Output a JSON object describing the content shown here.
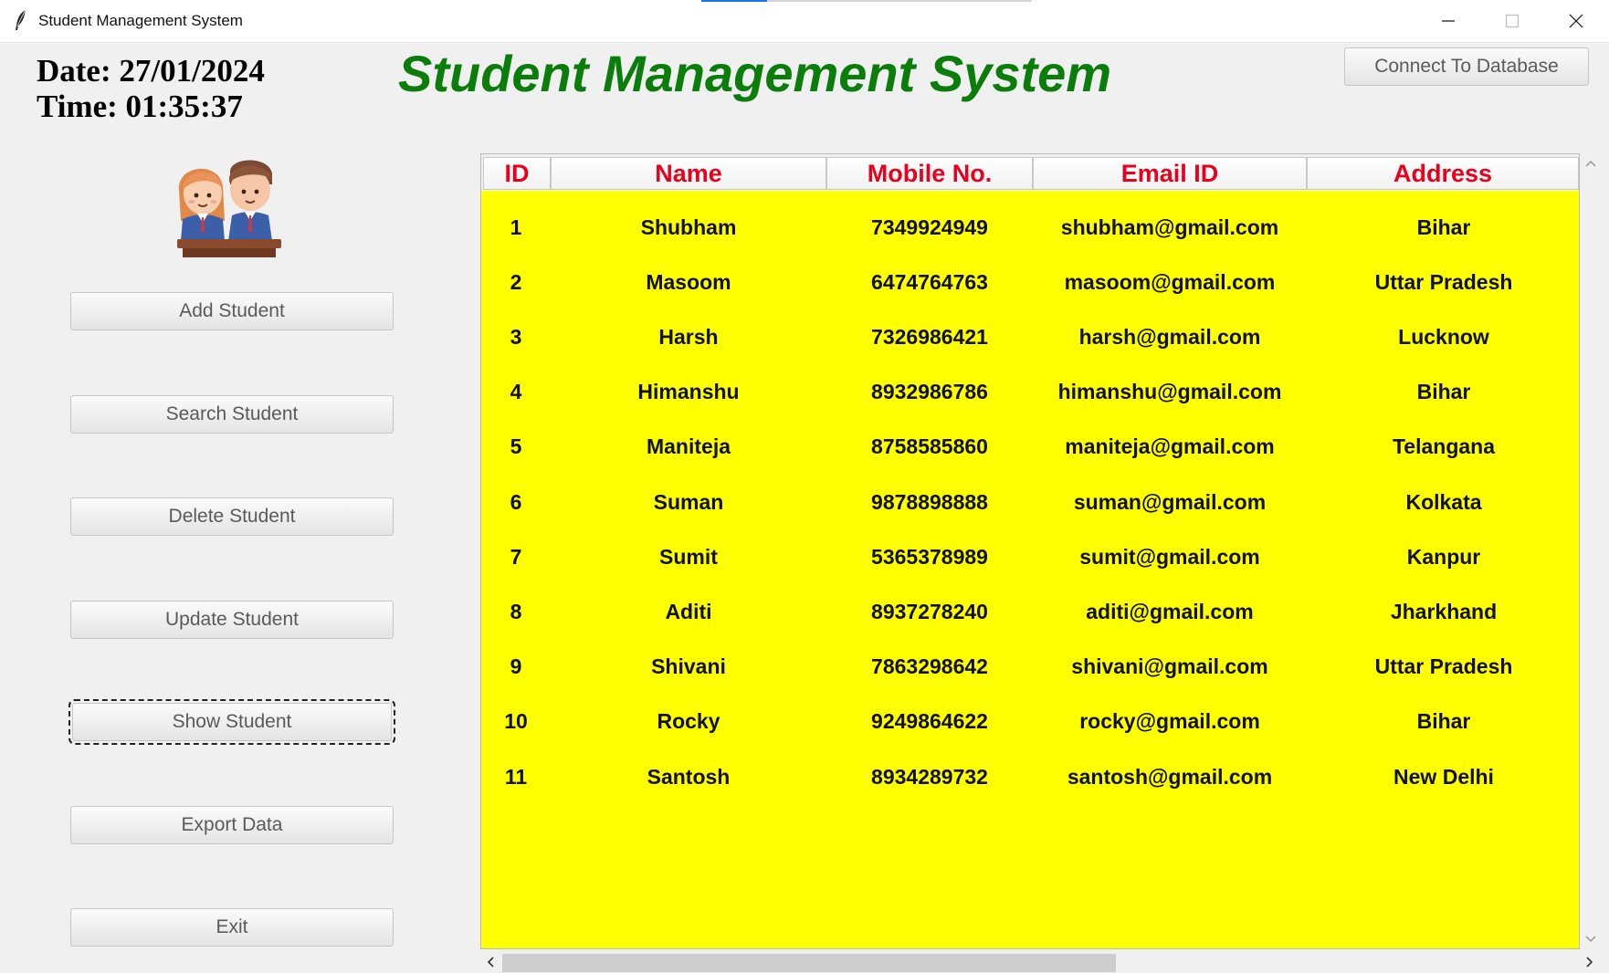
{
  "window": {
    "title": "Student Management System"
  },
  "clock": {
    "date": "Date: 27/01/2024",
    "time": "Time: 01:35:37"
  },
  "heading": "Student Management System",
  "connect_button": "Connect To Database",
  "sidebar": {
    "buttons": [
      {
        "label": "Add Student"
      },
      {
        "label": "Search Student"
      },
      {
        "label": "Delete Student"
      },
      {
        "label": "Update Student"
      },
      {
        "label": "Show Student",
        "focused": true
      },
      {
        "label": "Export Data"
      },
      {
        "label": "Exit"
      }
    ]
  },
  "table": {
    "columns": [
      "ID",
      "Name",
      "Mobile No.",
      "Email ID",
      "Address"
    ],
    "rows": [
      [
        "1",
        "Shubham",
        "7349924949",
        "shubham@gmail.com",
        "Bihar"
      ],
      [
        "2",
        "Masoom",
        "6474764763",
        "masoom@gmail.com",
        "Uttar Pradesh"
      ],
      [
        "3",
        "Harsh",
        "7326986421",
        "harsh@gmail.com",
        "Lucknow"
      ],
      [
        "4",
        "Himanshu",
        "8932986786",
        "himanshu@gmail.com",
        "Bihar"
      ],
      [
        "5",
        "Maniteja",
        "8758585860",
        "maniteja@gmail.com",
        "Telangana"
      ],
      [
        "6",
        "Suman",
        "9878898888",
        "suman@gmail.com",
        "Kolkata"
      ],
      [
        "7",
        "Sumit",
        "5365378989",
        "sumit@gmail.com",
        "Kanpur"
      ],
      [
        "8",
        "Aditi",
        "8937278240",
        "aditi@gmail.com",
        "Jharkhand"
      ],
      [
        "9",
        "Shivani",
        "7863298642",
        "shivani@gmail.com",
        "Uttar Pradesh"
      ],
      [
        "10",
        "Rocky",
        "9249864622",
        "rocky@gmail.com",
        "Bihar"
      ],
      [
        "11",
        "Santosh",
        "8934289732",
        "santosh@gmail.com",
        "New Delhi"
      ]
    ]
  },
  "colors": {
    "table_background": "#ffff00",
    "header_text": "#e8001c",
    "heading_text": "#0a7d0a"
  },
  "icons": [
    "feather-icon",
    "minimize-icon",
    "maximize-icon",
    "close-icon",
    "students-avatar-icon"
  ]
}
